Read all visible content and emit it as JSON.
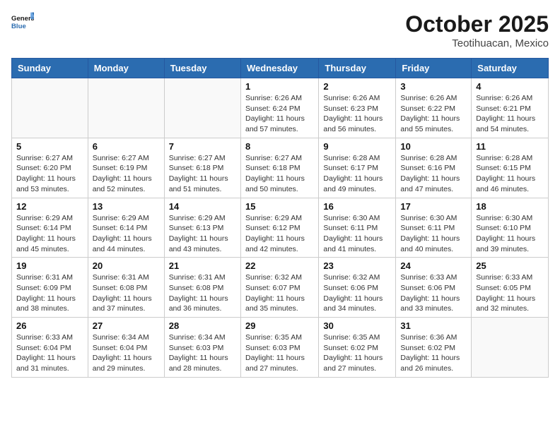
{
  "header": {
    "logo_line1": "General",
    "logo_line2": "Blue",
    "month": "October 2025",
    "location": "Teotihuacan, Mexico"
  },
  "weekdays": [
    "Sunday",
    "Monday",
    "Tuesday",
    "Wednesday",
    "Thursday",
    "Friday",
    "Saturday"
  ],
  "weeks": [
    [
      {
        "day": "",
        "info": ""
      },
      {
        "day": "",
        "info": ""
      },
      {
        "day": "",
        "info": ""
      },
      {
        "day": "1",
        "info": "Sunrise: 6:26 AM\nSunset: 6:24 PM\nDaylight: 11 hours\nand 57 minutes."
      },
      {
        "day": "2",
        "info": "Sunrise: 6:26 AM\nSunset: 6:23 PM\nDaylight: 11 hours\nand 56 minutes."
      },
      {
        "day": "3",
        "info": "Sunrise: 6:26 AM\nSunset: 6:22 PM\nDaylight: 11 hours\nand 55 minutes."
      },
      {
        "day": "4",
        "info": "Sunrise: 6:26 AM\nSunset: 6:21 PM\nDaylight: 11 hours\nand 54 minutes."
      }
    ],
    [
      {
        "day": "5",
        "info": "Sunrise: 6:27 AM\nSunset: 6:20 PM\nDaylight: 11 hours\nand 53 minutes."
      },
      {
        "day": "6",
        "info": "Sunrise: 6:27 AM\nSunset: 6:19 PM\nDaylight: 11 hours\nand 52 minutes."
      },
      {
        "day": "7",
        "info": "Sunrise: 6:27 AM\nSunset: 6:18 PM\nDaylight: 11 hours\nand 51 minutes."
      },
      {
        "day": "8",
        "info": "Sunrise: 6:27 AM\nSunset: 6:18 PM\nDaylight: 11 hours\nand 50 minutes."
      },
      {
        "day": "9",
        "info": "Sunrise: 6:28 AM\nSunset: 6:17 PM\nDaylight: 11 hours\nand 49 minutes."
      },
      {
        "day": "10",
        "info": "Sunrise: 6:28 AM\nSunset: 6:16 PM\nDaylight: 11 hours\nand 47 minutes."
      },
      {
        "day": "11",
        "info": "Sunrise: 6:28 AM\nSunset: 6:15 PM\nDaylight: 11 hours\nand 46 minutes."
      }
    ],
    [
      {
        "day": "12",
        "info": "Sunrise: 6:29 AM\nSunset: 6:14 PM\nDaylight: 11 hours\nand 45 minutes."
      },
      {
        "day": "13",
        "info": "Sunrise: 6:29 AM\nSunset: 6:14 PM\nDaylight: 11 hours\nand 44 minutes."
      },
      {
        "day": "14",
        "info": "Sunrise: 6:29 AM\nSunset: 6:13 PM\nDaylight: 11 hours\nand 43 minutes."
      },
      {
        "day": "15",
        "info": "Sunrise: 6:29 AM\nSunset: 6:12 PM\nDaylight: 11 hours\nand 42 minutes."
      },
      {
        "day": "16",
        "info": "Sunrise: 6:30 AM\nSunset: 6:11 PM\nDaylight: 11 hours\nand 41 minutes."
      },
      {
        "day": "17",
        "info": "Sunrise: 6:30 AM\nSunset: 6:11 PM\nDaylight: 11 hours\nand 40 minutes."
      },
      {
        "day": "18",
        "info": "Sunrise: 6:30 AM\nSunset: 6:10 PM\nDaylight: 11 hours\nand 39 minutes."
      }
    ],
    [
      {
        "day": "19",
        "info": "Sunrise: 6:31 AM\nSunset: 6:09 PM\nDaylight: 11 hours\nand 38 minutes."
      },
      {
        "day": "20",
        "info": "Sunrise: 6:31 AM\nSunset: 6:08 PM\nDaylight: 11 hours\nand 37 minutes."
      },
      {
        "day": "21",
        "info": "Sunrise: 6:31 AM\nSunset: 6:08 PM\nDaylight: 11 hours\nand 36 minutes."
      },
      {
        "day": "22",
        "info": "Sunrise: 6:32 AM\nSunset: 6:07 PM\nDaylight: 11 hours\nand 35 minutes."
      },
      {
        "day": "23",
        "info": "Sunrise: 6:32 AM\nSunset: 6:06 PM\nDaylight: 11 hours\nand 34 minutes."
      },
      {
        "day": "24",
        "info": "Sunrise: 6:33 AM\nSunset: 6:06 PM\nDaylight: 11 hours\nand 33 minutes."
      },
      {
        "day": "25",
        "info": "Sunrise: 6:33 AM\nSunset: 6:05 PM\nDaylight: 11 hours\nand 32 minutes."
      }
    ],
    [
      {
        "day": "26",
        "info": "Sunrise: 6:33 AM\nSunset: 6:04 PM\nDaylight: 11 hours\nand 31 minutes."
      },
      {
        "day": "27",
        "info": "Sunrise: 6:34 AM\nSunset: 6:04 PM\nDaylight: 11 hours\nand 29 minutes."
      },
      {
        "day": "28",
        "info": "Sunrise: 6:34 AM\nSunset: 6:03 PM\nDaylight: 11 hours\nand 28 minutes."
      },
      {
        "day": "29",
        "info": "Sunrise: 6:35 AM\nSunset: 6:03 PM\nDaylight: 11 hours\nand 27 minutes."
      },
      {
        "day": "30",
        "info": "Sunrise: 6:35 AM\nSunset: 6:02 PM\nDaylight: 11 hours\nand 27 minutes."
      },
      {
        "day": "31",
        "info": "Sunrise: 6:36 AM\nSunset: 6:02 PM\nDaylight: 11 hours\nand 26 minutes."
      },
      {
        "day": "",
        "info": ""
      }
    ]
  ]
}
